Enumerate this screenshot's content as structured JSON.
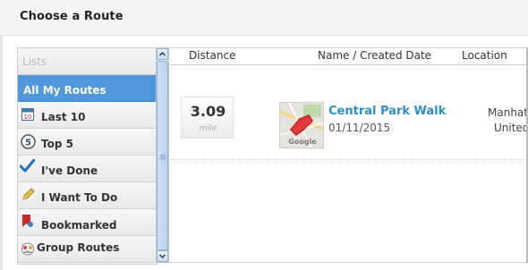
{
  "dialog": {
    "title": "Choose a Route"
  },
  "sidebar": {
    "header": "Lists",
    "items": [
      {
        "label": "All My Routes",
        "active": true,
        "icon": "none"
      },
      {
        "label": "Last 10",
        "icon": "calendar-icon"
      },
      {
        "label": "Top 5",
        "icon": "number-5-icon"
      },
      {
        "label": "I've Done",
        "icon": "checkmark-icon"
      },
      {
        "label": "I Want To Do",
        "icon": "pencil-icon"
      },
      {
        "label": "Bookmarked",
        "icon": "bookmark-icon"
      },
      {
        "label": "Group Routes",
        "icon": "group-icon"
      }
    ]
  },
  "table": {
    "columns": [
      "Distance",
      "Name / Created Date",
      "Location"
    ],
    "rows": [
      {
        "distance": "3.09",
        "unit": "mile",
        "name": "Central Park Walk",
        "created": "01/11/2015",
        "location_line1": "Manhat",
        "location_line2": "United",
        "thumbnail": "google-map-thumbnail"
      }
    ]
  },
  "colors": {
    "accent": "#4e97dd",
    "link": "#2a8fc7"
  }
}
